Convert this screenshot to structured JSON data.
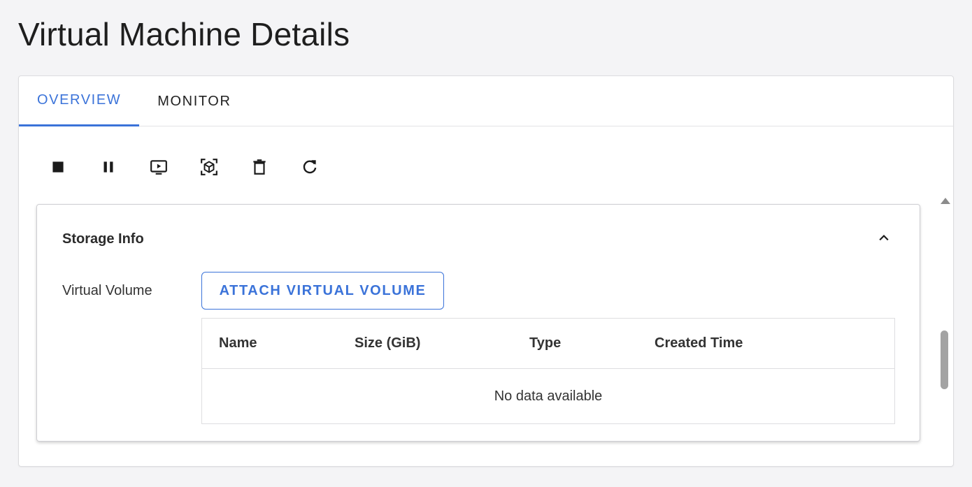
{
  "page": {
    "title": "Virtual Machine Details"
  },
  "tabs": [
    {
      "label": "OVERVIEW",
      "active": true
    },
    {
      "label": "MONITOR",
      "active": false
    }
  ],
  "toolbar": {
    "buttons": [
      {
        "icon": "stop-icon"
      },
      {
        "icon": "pause-icon"
      },
      {
        "icon": "console-icon"
      },
      {
        "icon": "snapshot-icon"
      },
      {
        "icon": "delete-icon"
      },
      {
        "icon": "refresh-icon"
      }
    ]
  },
  "storage": {
    "title": "Storage Info",
    "field_label": "Virtual Volume",
    "attach_label": "ATTACH VIRTUAL VOLUME",
    "columns": [
      "Name",
      "Size (GiB)",
      "Type",
      "Created Time"
    ],
    "rows": [],
    "empty_text": "No data available"
  },
  "colors": {
    "accent": "#3b73d9",
    "background": "#f4f4f6"
  }
}
